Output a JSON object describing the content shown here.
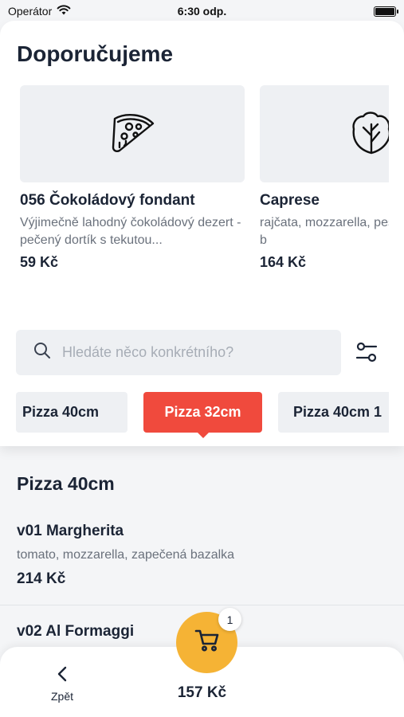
{
  "status_bar": {
    "carrier": "Operátor",
    "time": "6:30 odp."
  },
  "recommended": {
    "title": "Doporučujeme",
    "items": [
      {
        "name": "056 Čokoládový fondant",
        "description": "Výjimečně lahodný čokoládový dezert - pečený dortík s tekutou...",
        "price": "59 Kč",
        "icon": "pizza-slice-icon"
      },
      {
        "name": "Caprese",
        "description": "rajčata, mozzarella, pesto, olivový olej, b",
        "price": "164 Kč",
        "icon": "lettuce-icon"
      }
    ]
  },
  "search": {
    "placeholder": "Hledáte něco konkrétního?"
  },
  "categories": {
    "tabs": [
      "Pizza 40cm",
      "Pizza 32cm",
      "Pizza 40cm 1"
    ],
    "selected": "Pizza 32cm",
    "active_color": "#f04a3d"
  },
  "menu_section": {
    "title": "Pizza 40cm",
    "items": [
      {
        "name": "v01 Margherita",
        "description": "tomato, mozzarella, zapečená bazalka",
        "price": "214 Kč"
      },
      {
        "name": "v02 Al Formaggi"
      }
    ]
  },
  "bottom_bar": {
    "back_label": "Zpět",
    "total": "157 Kč",
    "cart_count": "1",
    "cart_color": "#f5b335"
  }
}
